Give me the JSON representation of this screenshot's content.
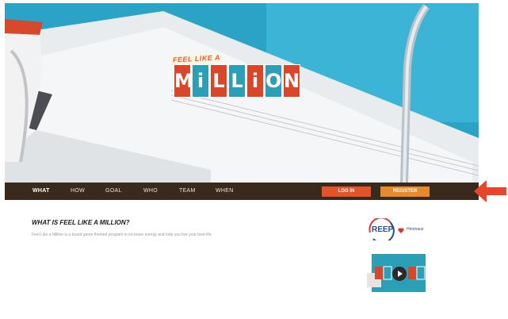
{
  "hero": {
    "logo_top": "FEEL LIKE A",
    "logo_letters": [
      "M",
      "i",
      "L",
      "L",
      "i",
      "O",
      "N"
    ],
    "tile_colors": [
      "#d9472b",
      "#2b9fb5",
      "#d9472b",
      "#2b9fb5",
      "#d9472b",
      "#2b9fb5",
      "#d9472b"
    ]
  },
  "nav": {
    "items": [
      "WHAT",
      "HOW",
      "GOAL",
      "WHO",
      "TEAM",
      "WHEN"
    ],
    "login": "LOG IN",
    "register": "REGISTER",
    "login_color": "#e5532b",
    "register_color": "#e8892a"
  },
  "main": {
    "title": "WHAT IS FEEL LIKE A MILLION?",
    "description": "Feel Like a Million is a board game themed program to increase energy and help you live your best life."
  },
  "sidebar": {
    "reep_label": "REEP",
    "partner_label": "Hirnmaus"
  },
  "colors": {
    "pool": "#2aa3c7",
    "nav_bg": "#3a2a1e",
    "arrow": "#e8452b"
  }
}
